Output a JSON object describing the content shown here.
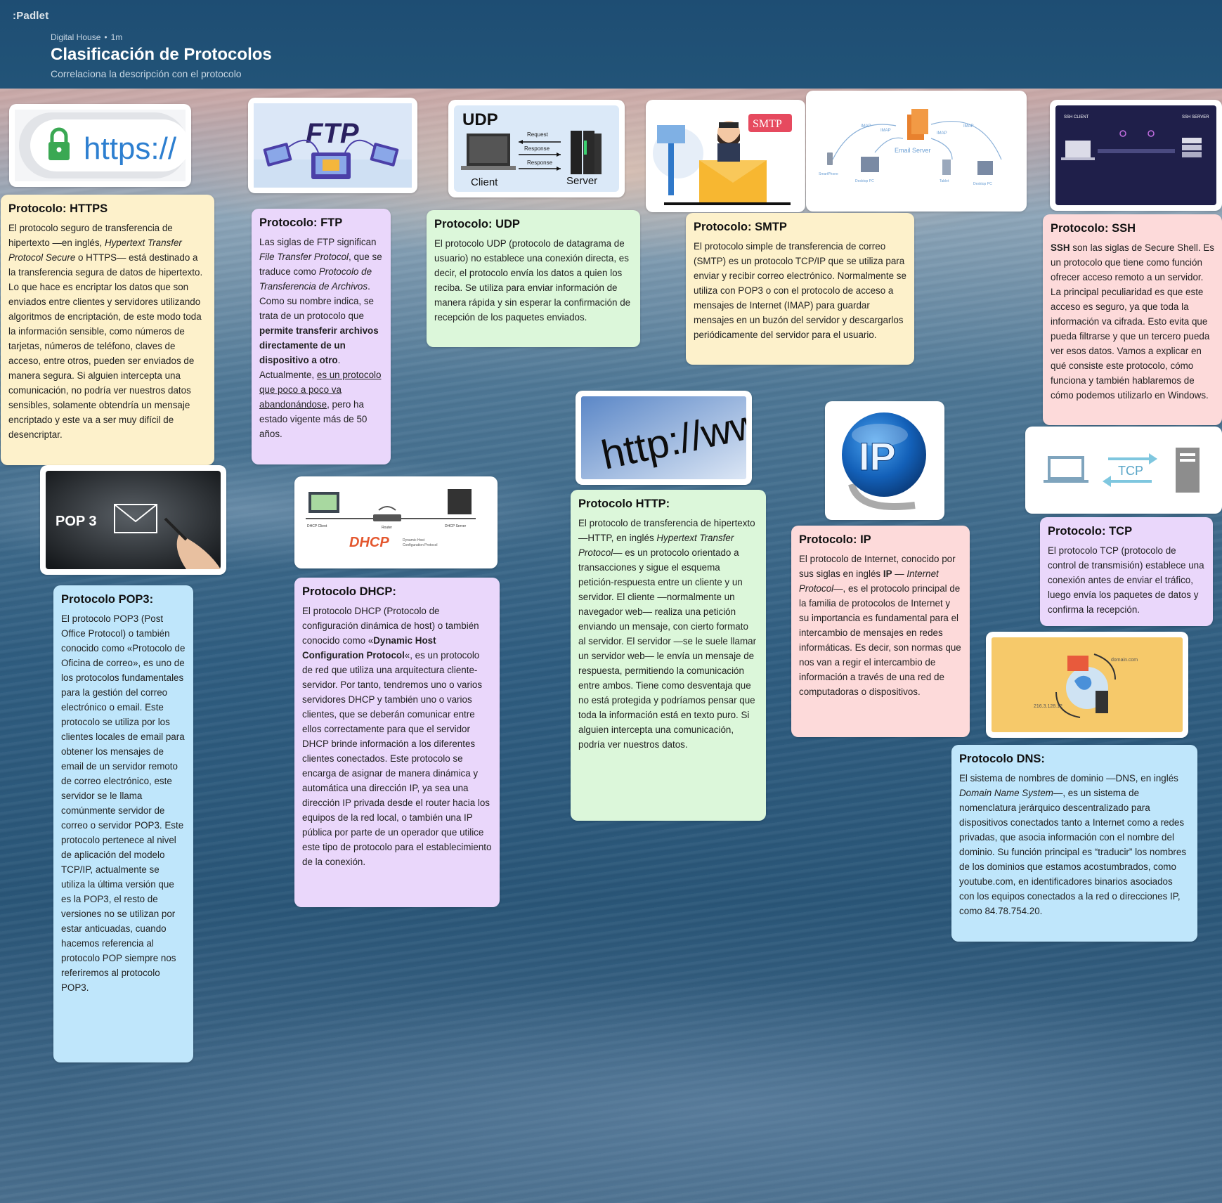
{
  "header": {
    "logo": ":Padlet",
    "author": "Digital House",
    "time": "1m",
    "title": "Clasificación de Protocolos",
    "subtitle": "Correlaciona la descripción con el protocolo"
  },
  "images": {
    "https_text": "https://",
    "ftp_text": "FTP",
    "udp_title": "UDP",
    "udp_request": "Request",
    "udp_response1": "Response",
    "udp_response2": "Response",
    "udp_client": "Client",
    "udp_server": "Server",
    "smtp_badge": "SMTP",
    "email_server": "Email Server",
    "imap1": "IMAP",
    "imap2": "IMAP",
    "imap3": "IMAP",
    "imap4": "IMAP",
    "smartphone": "SmartPhone",
    "desktop1": "Desktop PC",
    "tablet": "Tablet",
    "desktop2": "Desktop PC",
    "ssh_client": "SSH CLIENT",
    "ssh_server": "SSH SERVER",
    "pop3_text": "POP 3",
    "dhcp_client": "DHCP Client",
    "dhcp_router": "Router",
    "dhcp_server": "DHCP Server",
    "dhcp_logo": "DHCP",
    "dhcp_sub1": "Dynamic Host",
    "dhcp_sub2": "Configuration Protocol",
    "http_text": "http://www",
    "ip_text": "IP",
    "tcp_text": "TCP",
    "dns_domain": "domain.com",
    "dns_ip": "216.3.128.12"
  },
  "cards": {
    "https": {
      "title": "Protocolo: HTTPS",
      "t1": "El protocolo seguro de transferencia de hipertexto —en inglés, ",
      "t2": "Hypertext Transfer Protocol Secure",
      "t3": " o HTTPS— está destinado a la transferencia segura de datos de hipertexto. Lo que hace es encriptar los datos que son enviados entre clientes y servidores utilizando algoritmos de encriptación, de este modo toda la información sensible, como números de tarjetas, números de teléfono, claves de acceso, entre otros, pueden ser enviados de manera segura. Si alguien intercepta una comunicación, no podría ver nuestros datos sensibles, solamente obtendría un mensaje encriptado y este va a ser muy difícil de desencriptar."
    },
    "ftp": {
      "title": "Protocolo: FTP",
      "t1": "Las siglas de FTP significan ",
      "t2": "File Transfer Protocol",
      "t3": ", que se traduce como ",
      "t4": "Protocolo de Transferencia de Archivos",
      "t5": ". Como su nombre indica, se trata de un protocolo que ",
      "t6": "permite transferir archivos directamente de un dispositivo a otro",
      "t7": ". Actualmente, ",
      "t8": "es un protocolo que poco a poco va abandonándose",
      "t9": ", pero ha estado vigente más de 50 años."
    },
    "udp": {
      "title": "Protocolo: UDP",
      "text": "El protocolo UDP (protocolo de datagrama de usuario) no establece una conexión directa, es decir, el protocolo envía los datos a quien los reciba. Se utiliza para enviar información de manera rápida y sin esperar la confirmación de recepción de los paquetes enviados."
    },
    "smtp": {
      "title": "Protocolo: SMTP",
      "text": "El protocolo simple de transferencia de correo (SMTP) es un protocolo TCP/IP que se utiliza para enviar y recibir correo electrónico. Normalmente se utiliza con POP3 o con el protocolo de acceso a mensajes de Internet (IMAP) para guardar mensajes en un buzón del servidor y descargarlos periódicamente del servidor para el usuario."
    },
    "ssh": {
      "title": "Protocolo: SSH",
      "t1": "SSH",
      "t2": " son las siglas de Secure Shell. Es un protocolo que tiene como función ofrecer acceso remoto a un servidor. La principal peculiaridad es que este acceso es seguro, ya que toda la información va cifrada. Esto evita que pueda filtrarse y que un tercero pueda ver esos datos. Vamos a explicar en qué consiste este protocolo, cómo funciona y también hablaremos de cómo podemos utilizarlo en Windows."
    },
    "pop3": {
      "title": "Protocolo POP3:",
      "text": "El protocolo POP3 (Post Office Protocol) o también conocido como «Protocolo de Oficina de correo», es uno de los protocolos fundamentales para la gestión del correo electrónico o email. Este protocolo se utiliza por los clientes locales de email para obtener los mensajes de email de un servidor remoto de correo electrónico, este servidor se le llama comúnmente servidor de correo o servidor POP3. Este protocolo pertenece al nivel de aplicación del modelo TCP/IP, actualmente se utiliza la última versión que es la POP3, el resto de versiones no se utilizan por estar anticuadas, cuando hacemos referencia al protocolo POP siempre nos referiremos al protocolo POP3."
    },
    "dhcp": {
      "title": "Protocolo DHCP:",
      "t1": "El protocolo DHCP (Protocolo de configuración dinámica de host) o también conocido como «",
      "t2": "Dynamic Host Configuration Protocol",
      "t3": "«, es un protocolo de red que utiliza una arquitectura cliente-servidor. Por tanto, tendremos uno o varios servidores DHCP y también uno o varios clientes, que se deberán comunicar entre ellos correctamente para que el servidor DHCP brinde información a los diferentes clientes conectados. Este protocolo se encarga de asignar de manera dinámica y automática una dirección IP, ya sea una dirección IP privada desde el router hacia los equipos de la red local, o también una IP pública por parte de un operador que utilice este tipo de protocolo para el establecimiento de la conexión."
    },
    "http": {
      "title": "Protocolo HTTP:",
      "t1": "El protocolo de transferencia de hipertexto —HTTP, en inglés ",
      "t2": "Hypertext Transfer Protocol",
      "t3": "— es un protocolo orientado a transacciones y sigue el esquema petición-respuesta entre un cliente y un servidor. El cliente —normalmente un navegador web— realiza una petición enviando un mensaje, con cierto formato al servidor. El servidor —se le suele llamar un servidor web— le envía un mensaje de respuesta, permitiendo la comunicación entre ambos. Tiene como desventaja que no está protegida y podríamos pensar que toda la información está en texto puro. Si alguien intercepta una comunicación, podría ver nuestros datos."
    },
    "ip": {
      "title": "Protocolo: IP",
      "t1": "El protocolo de Internet, conocido por sus siglas en inglés ",
      "t2": "IP",
      "t3": " — ",
      "t4": "Internet Protocol",
      "t5": "—, es el protocolo principal de la familia de protocolos de Internet y su importancia es fundamental para el intercambio de mensajes en redes informáticas. Es decir, son normas que nos van a regir el intercambio de información a través de una red de computadoras o dispositivos."
    },
    "tcp": {
      "title": "Protocolo: TCP",
      "text": "El protocolo TCP (protocolo de control de transmisión) establece una conexión antes de enviar el tráfico, luego envía los paquetes de datos y confirma la recepción."
    },
    "dns": {
      "title": "Protocolo DNS:",
      "t1": "El sistema de nombres de dominio —DNS, en inglés ",
      "t2": "Domain Name System",
      "t3": "—, es un sistema de nomenclatura jerárquico descentralizado para dispositivos conectados tanto a Internet como a redes privadas, que asocia información con el nombre del dominio. Su función principal es “traducir” los nombres de los dominios que estamos acostumbrados, como youtube.com, en identificadores binarios asociados con los equipos conectados a la red o direcciones IP, como 84.78.754.20."
    }
  }
}
